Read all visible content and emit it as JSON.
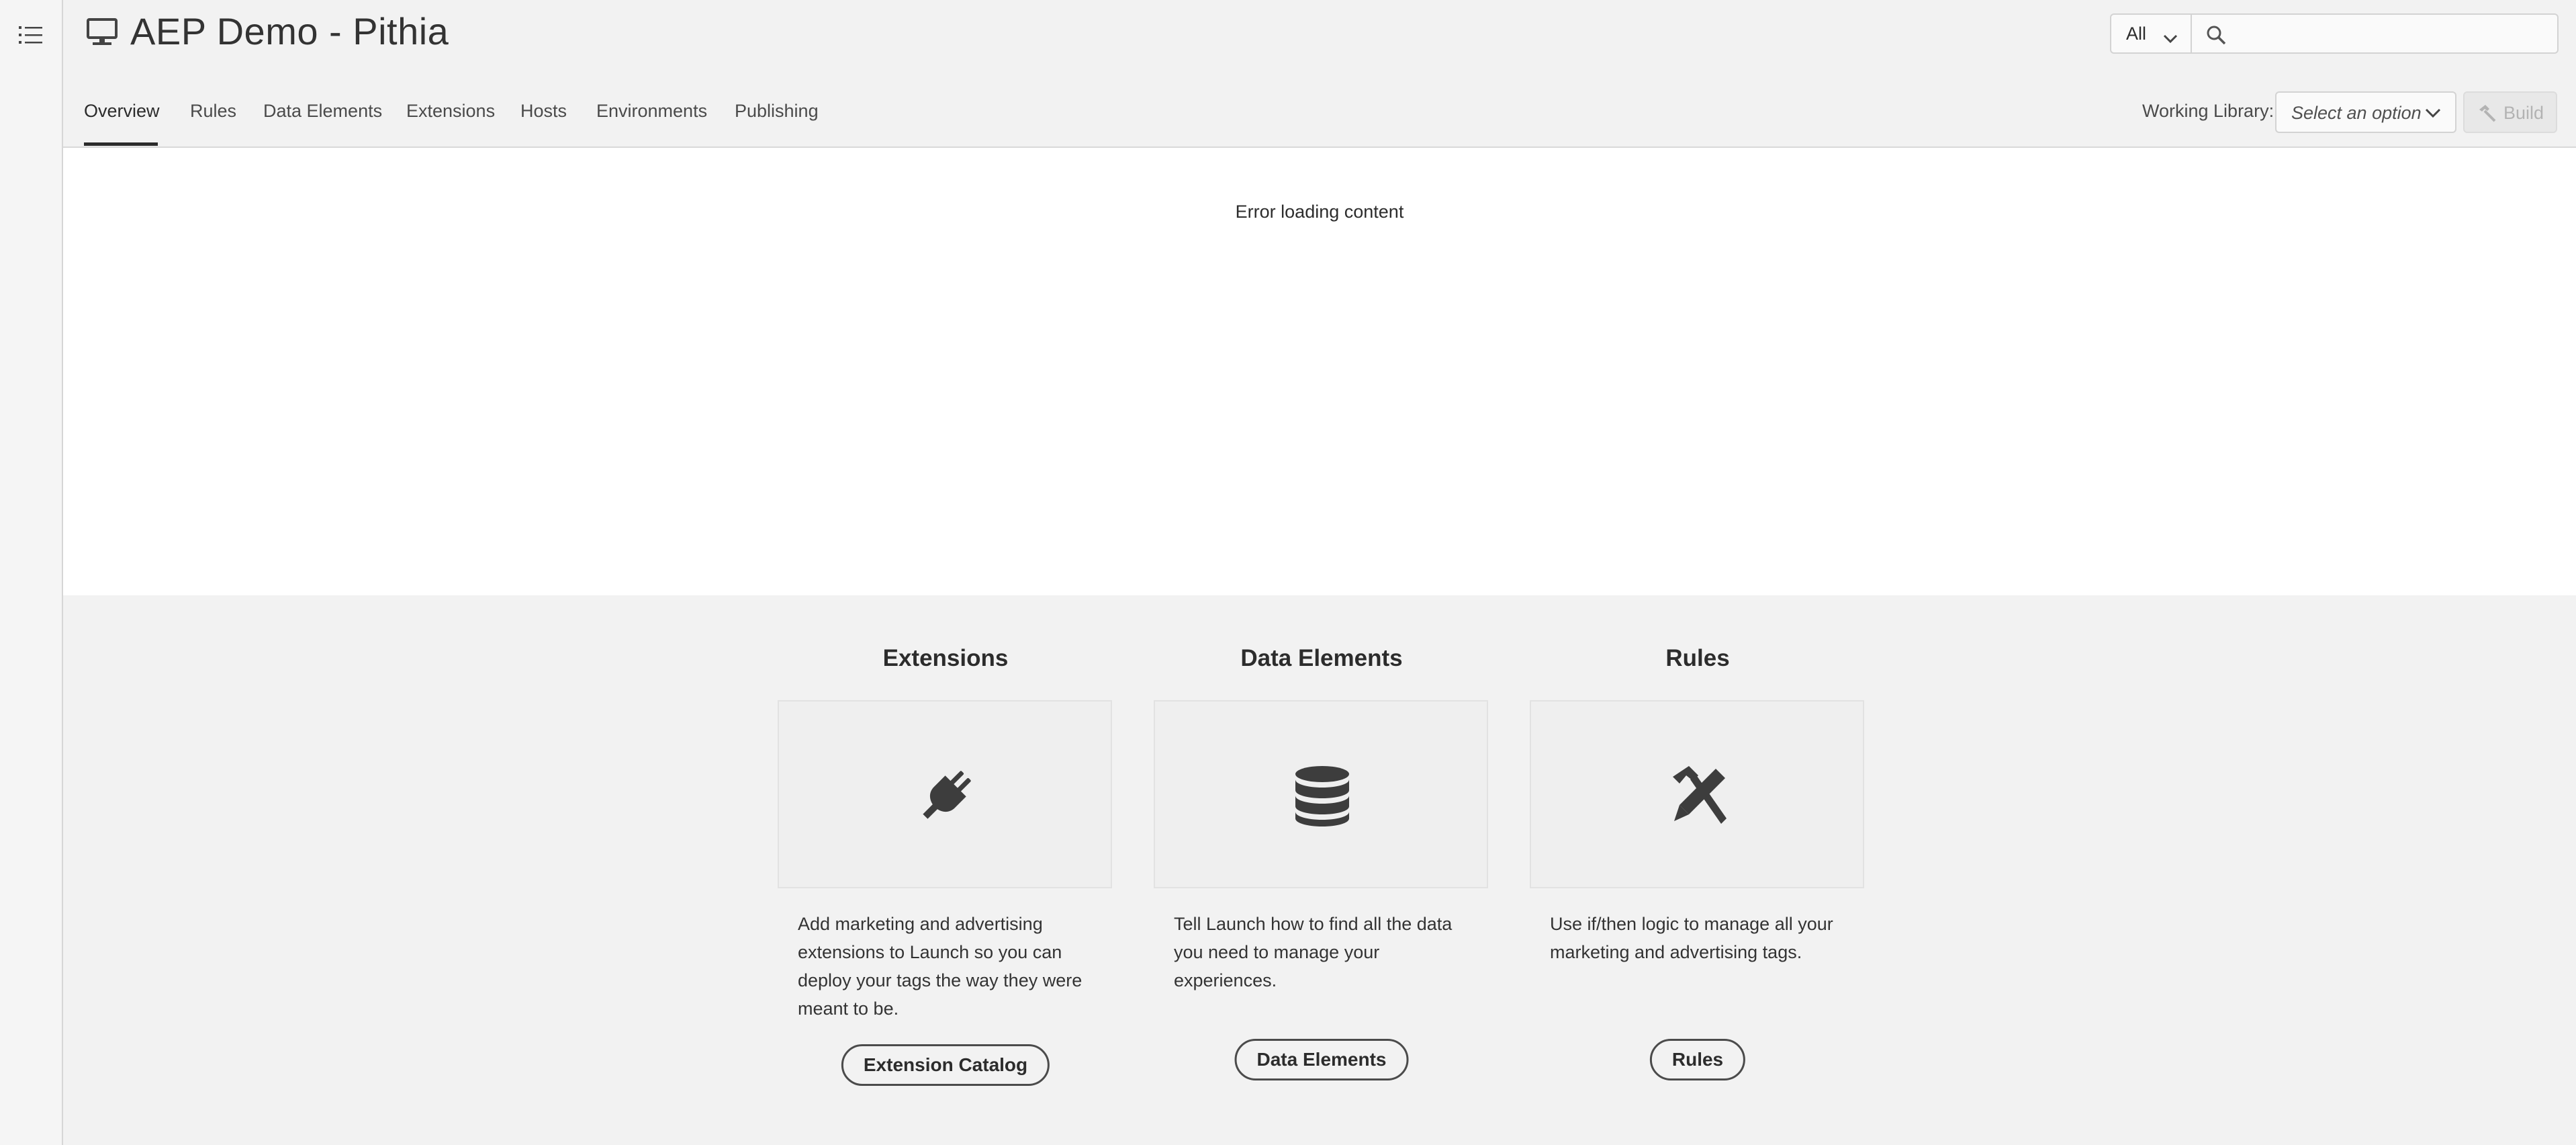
{
  "rail": {
    "menu_icon": "list-icon"
  },
  "header": {
    "title": "AEP Demo - Pithia",
    "title_icon": "monitor-icon",
    "scope_select": "All",
    "search": {
      "value": "",
      "placeholder": ""
    }
  },
  "tabs": [
    {
      "label": "Overview",
      "active": true
    },
    {
      "label": "Rules"
    },
    {
      "label": "Data Elements"
    },
    {
      "label": "Extensions"
    },
    {
      "label": "Hosts"
    },
    {
      "label": "Environments"
    },
    {
      "label": "Publishing"
    }
  ],
  "library": {
    "label": "Working Library:",
    "placeholder": "Select an option",
    "build_label": "Build"
  },
  "content": {
    "error": "Error loading content"
  },
  "cards": [
    {
      "title": "Extensions",
      "icon": "plug-icon",
      "description": "Add marketing and advertising extensions to Launch so you can deploy your tags the way they were meant to be.",
      "button": "Extension Catalog"
    },
    {
      "title": "Data Elements",
      "icon": "database-icon",
      "description": "Tell Launch how to find all the data you need to manage your experiences.",
      "button": "Data Elements"
    },
    {
      "title": "Rules",
      "icon": "hammer-pencil-icon",
      "description": "Use if/then logic to manage all your marketing and advertising tags.",
      "button": "Rules"
    }
  ],
  "colors": {
    "background": "#f2f2f2",
    "panel": "#ffffff",
    "text": "#2c2c2c",
    "disabled": "#b3b3b3"
  }
}
